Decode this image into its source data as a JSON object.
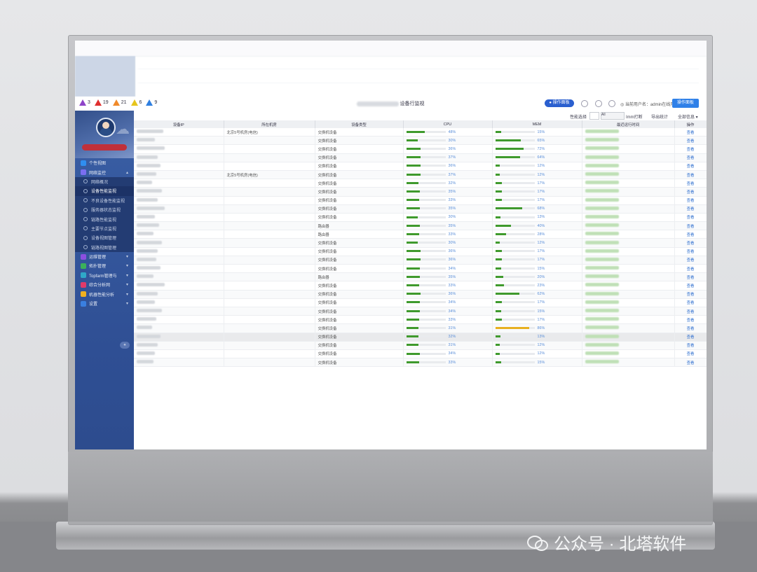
{
  "watermark": "公众号 · 北塔软件",
  "topbar": {
    "alerts": [
      {
        "color": "#8e44c8",
        "count": "3"
      },
      {
        "color": "#e03030",
        "count": "19"
      },
      {
        "color": "#f08a2a",
        "count": "21"
      },
      {
        "color": "#e6c51c",
        "count": "6"
      },
      {
        "color": "#2f7fe0",
        "count": "9"
      }
    ],
    "title_suffix": "设备行监视",
    "pill_button": "● 操作面板",
    "user_text": "◎ 当前用户名：admin在线用户",
    "action_button": "操作面板"
  },
  "sidebar": {
    "items": [
      {
        "label": "个性视图",
        "color": "#2f8ef0",
        "type": "top"
      },
      {
        "label": "网络监控",
        "color": "#7a6ef0",
        "type": "top",
        "chev": "▴"
      },
      {
        "label": "网络概况",
        "type": "sub"
      },
      {
        "label": "设备性能监视",
        "type": "sub",
        "active": true
      },
      {
        "label": "不良设备性能监视",
        "type": "sub"
      },
      {
        "label": "服务器状态监视",
        "type": "sub"
      },
      {
        "label": "链路性能监视",
        "type": "sub"
      },
      {
        "label": "主要节点监视",
        "type": "sub"
      },
      {
        "label": "设备视图管理",
        "type": "sub"
      },
      {
        "label": "链路视图管理",
        "type": "sub"
      },
      {
        "label": "运维管理",
        "color": "#8c4fe0",
        "type": "top",
        "chev": "▾"
      },
      {
        "label": "拓扑管理",
        "color": "#3bb15a",
        "type": "top",
        "chev": "▾"
      },
      {
        "label": "Topfarm管理与",
        "color": "#2fa8c8",
        "type": "top",
        "chev": "▾"
      },
      {
        "label": "综合分析网",
        "color": "#e03a6a",
        "type": "top",
        "chev": "▾"
      },
      {
        "label": "机器性能分析",
        "color": "#f0b020",
        "type": "top",
        "chev": "▾"
      },
      {
        "label": "设置",
        "color": "#3a7fe0",
        "type": "top",
        "chev": "▾"
      }
    ],
    "collapse": "«"
  },
  "toolbar": {
    "filter_label": "性能选择",
    "toggle_text": "All",
    "search_hint": "Imm打断",
    "export_hint": "导出统计",
    "more_label": "全部信息 ▾"
  },
  "table": {
    "headers": [
      "设备IP",
      "所在机房",
      "设备类型",
      "CPU",
      "MEM",
      "最近运行时间",
      "操作"
    ],
    "rows": [
      {
        "loc": "北京5号机房(电信) ",
        "type": "交换机设备",
        "cpu": 48,
        "mem": 15,
        "warn": false
      },
      {
        "loc": "",
        "type": "交换机设备",
        "cpu": 30,
        "mem": 65,
        "warn": false
      },
      {
        "loc": "",
        "type": "交换机设备",
        "cpu": 36,
        "mem": 72,
        "warn": false
      },
      {
        "loc": "",
        "type": "交换机设备",
        "cpu": 37,
        "mem": 64,
        "warn": false
      },
      {
        "loc": "",
        "type": "交换机设备",
        "cpu": 36,
        "mem": 12,
        "warn": false
      },
      {
        "loc": "北京5号机房(电信)",
        "type": "交换机设备",
        "cpu": 37,
        "mem": 12,
        "warn": false
      },
      {
        "loc": "",
        "type": "交换机设备",
        "cpu": 32,
        "mem": 17,
        "warn": false
      },
      {
        "loc": "",
        "type": "交换机设备",
        "cpu": 35,
        "mem": 17,
        "warn": false
      },
      {
        "loc": "",
        "type": "交换机设备",
        "cpu": 33,
        "mem": 17,
        "warn": false
      },
      {
        "loc": "",
        "type": "交换机设备",
        "cpu": 35,
        "mem": 68,
        "warn": false
      },
      {
        "loc": "",
        "type": "交换机设备",
        "cpu": 30,
        "mem": 13,
        "warn": false
      },
      {
        "loc": "",
        "type": "路由器",
        "cpu": 35,
        "mem": 40,
        "warn": false
      },
      {
        "loc": "",
        "type": "路由器",
        "cpu": 33,
        "mem": 28,
        "warn": false
      },
      {
        "loc": "",
        "type": "交换机设备",
        "cpu": 30,
        "mem": 12,
        "warn": false
      },
      {
        "loc": "",
        "type": "交换机设备",
        "cpu": 36,
        "mem": 17,
        "warn": false
      },
      {
        "loc": "",
        "type": "交换机设备",
        "cpu": 36,
        "mem": 17,
        "warn": false
      },
      {
        "loc": "",
        "type": "交换机设备",
        "cpu": 34,
        "mem": 15,
        "warn": false
      },
      {
        "loc": "",
        "type": "路由器",
        "cpu": 35,
        "mem": 20,
        "warn": false
      },
      {
        "loc": "",
        "type": "交换机设备",
        "cpu": 33,
        "mem": 23,
        "warn": false
      },
      {
        "loc": "",
        "type": "交换机设备",
        "cpu": 36,
        "mem": 62,
        "warn": false
      },
      {
        "loc": "",
        "type": "交换机设备",
        "cpu": 34,
        "mem": 17,
        "warn": false
      },
      {
        "loc": "",
        "type": "交换机设备",
        "cpu": 34,
        "mem": 15,
        "warn": false
      },
      {
        "loc": "",
        "type": "交换机设备",
        "cpu": 33,
        "mem": 17,
        "warn": false
      },
      {
        "loc": "",
        "type": "交换机设备",
        "cpu": 31,
        "mem": 86,
        "warn": true
      },
      {
        "loc": "",
        "type": "交换机设备",
        "cpu": 32,
        "mem": 13,
        "warn": false
      },
      {
        "loc": "",
        "type": "交换机设备",
        "cpu": 31,
        "mem": 12,
        "warn": false
      },
      {
        "loc": "",
        "type": "交换机设备",
        "cpu": 34,
        "mem": 12,
        "warn": false
      },
      {
        "loc": "",
        "type": "交换机设备",
        "cpu": 33,
        "mem": 15,
        "warn": false
      }
    ],
    "op_label": "查看"
  }
}
